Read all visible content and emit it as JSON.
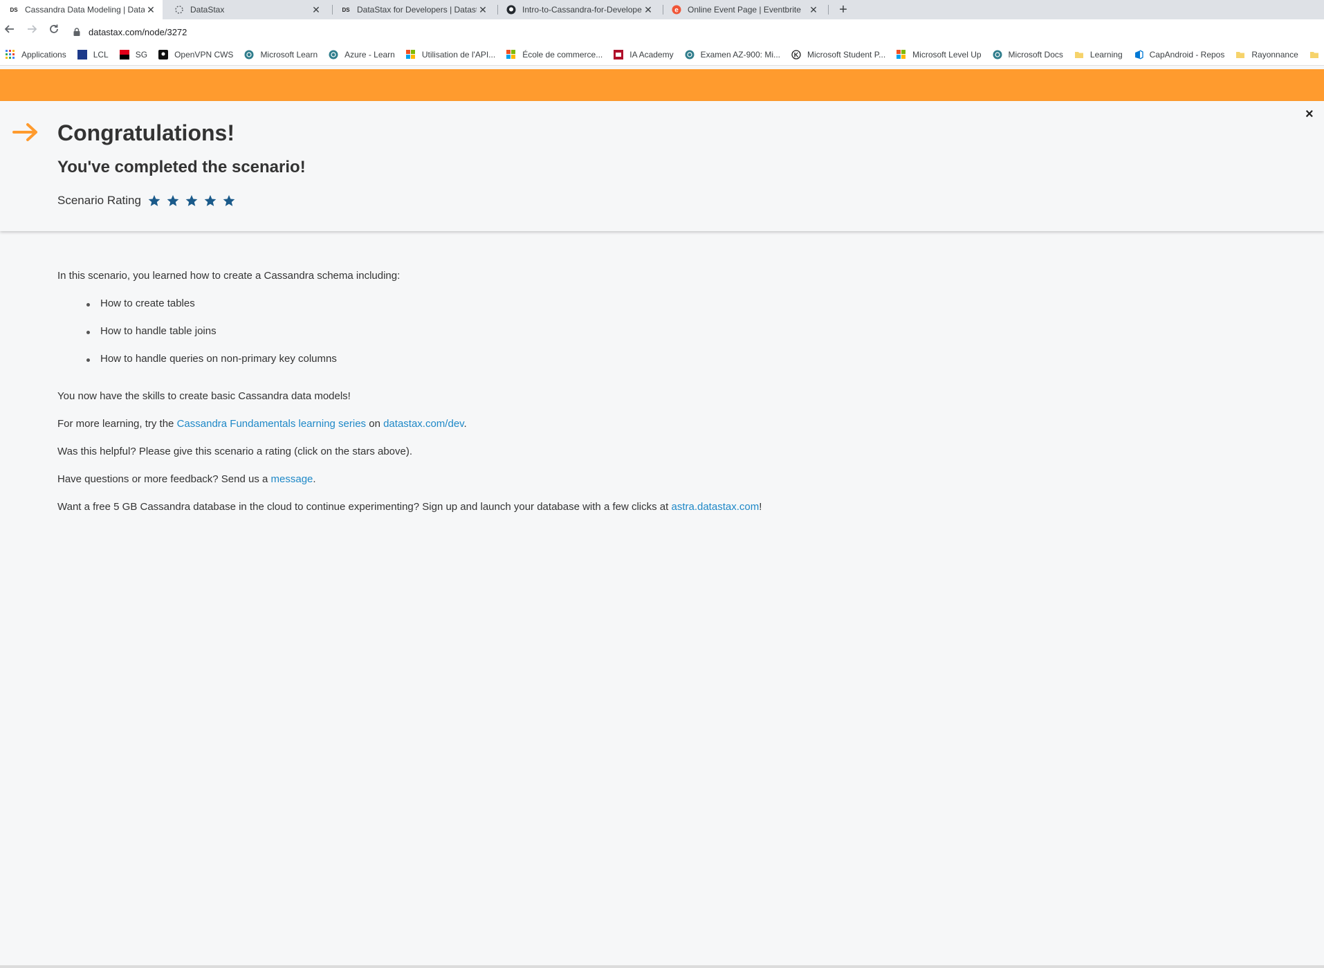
{
  "browser": {
    "tabs": [
      {
        "title": "Cassandra Data Modeling | Datas",
        "icon": "datastax-ds-icon",
        "active": true
      },
      {
        "title": "DataStax",
        "icon": "datastax-logo-icon",
        "active": false
      },
      {
        "title": "DataStax for Developers | Datast",
        "icon": "datastax-ds-icon",
        "active": false
      },
      {
        "title": "Intro-to-Cassandra-for-Develope",
        "icon": "github-icon",
        "active": false
      },
      {
        "title": "Online Event Page | Eventbrite",
        "icon": "eventbrite-icon",
        "active": false
      }
    ],
    "new_tab": "+",
    "url": "datastax.com/node/3272",
    "bookmarks": [
      {
        "label": "Applications",
        "icon": "apps-grid-icon"
      },
      {
        "label": "LCL",
        "icon": "lcl-icon"
      },
      {
        "label": "SG",
        "icon": "sg-icon"
      },
      {
        "label": "OpenVPN CWS",
        "icon": "openvpn-icon"
      },
      {
        "label": "Microsoft Learn",
        "icon": "ms-learn-icon"
      },
      {
        "label": "Azure - Learn",
        "icon": "ms-learn-icon"
      },
      {
        "label": "Utilisation de l'API...",
        "icon": "microsoft-icon"
      },
      {
        "label": "École de commerce...",
        "icon": "microsoft-icon"
      },
      {
        "label": "IA Academy",
        "icon": "ia-academy-icon"
      },
      {
        "label": "Examen AZ-900: Mi...",
        "icon": "ms-learn-icon"
      },
      {
        "label": "Microsoft Student P...",
        "icon": "k-icon"
      },
      {
        "label": "Microsoft Level Up",
        "icon": "microsoft-icon"
      },
      {
        "label": "Microsoft Docs",
        "icon": "ms-learn-icon"
      },
      {
        "label": "Learning",
        "icon": "folder-icon"
      },
      {
        "label": "CapAndroid - Repos",
        "icon": "azure-devops-icon"
      },
      {
        "label": "Rayonnance",
        "icon": "folder-icon"
      }
    ]
  },
  "banner": {
    "title": "Congratulations!",
    "subtitle": "You've completed the scenario!",
    "rating_label": "Scenario Rating",
    "rating_value": 5,
    "rating_max": 5,
    "close": "×"
  },
  "content": {
    "intro": "In this scenario, you learned how to create a Cassandra schema including:",
    "items": [
      "How to create tables",
      "How to handle table joins",
      "How to handle queries on non-primary key columns"
    ],
    "skills": "You now have the skills to create basic Cassandra data models!",
    "learning_prefix": "For more learning, try the ",
    "learning_link": "Cassandra Fundamentals learning series",
    "learning_mid": " on ",
    "learning_link2": "datastax.com/dev",
    "learning_suffix": ".",
    "helpful": "Was this helpful? Please give this scenario a rating (click on the stars above).",
    "questions_prefix": "Have questions or more feedback? Send us a ",
    "questions_link": "message",
    "questions_suffix": ".",
    "astra_prefix": "Want a free 5 GB Cassandra database in the cloud to continue experimenting? Sign up and launch your database with a few clicks at ",
    "astra_link": "astra.datastax.com",
    "astra_suffix": "!"
  },
  "colors": {
    "accent_orange": "#ff9b2e",
    "star_blue": "#1a5a8a",
    "link_blue": "#1e88c7"
  }
}
